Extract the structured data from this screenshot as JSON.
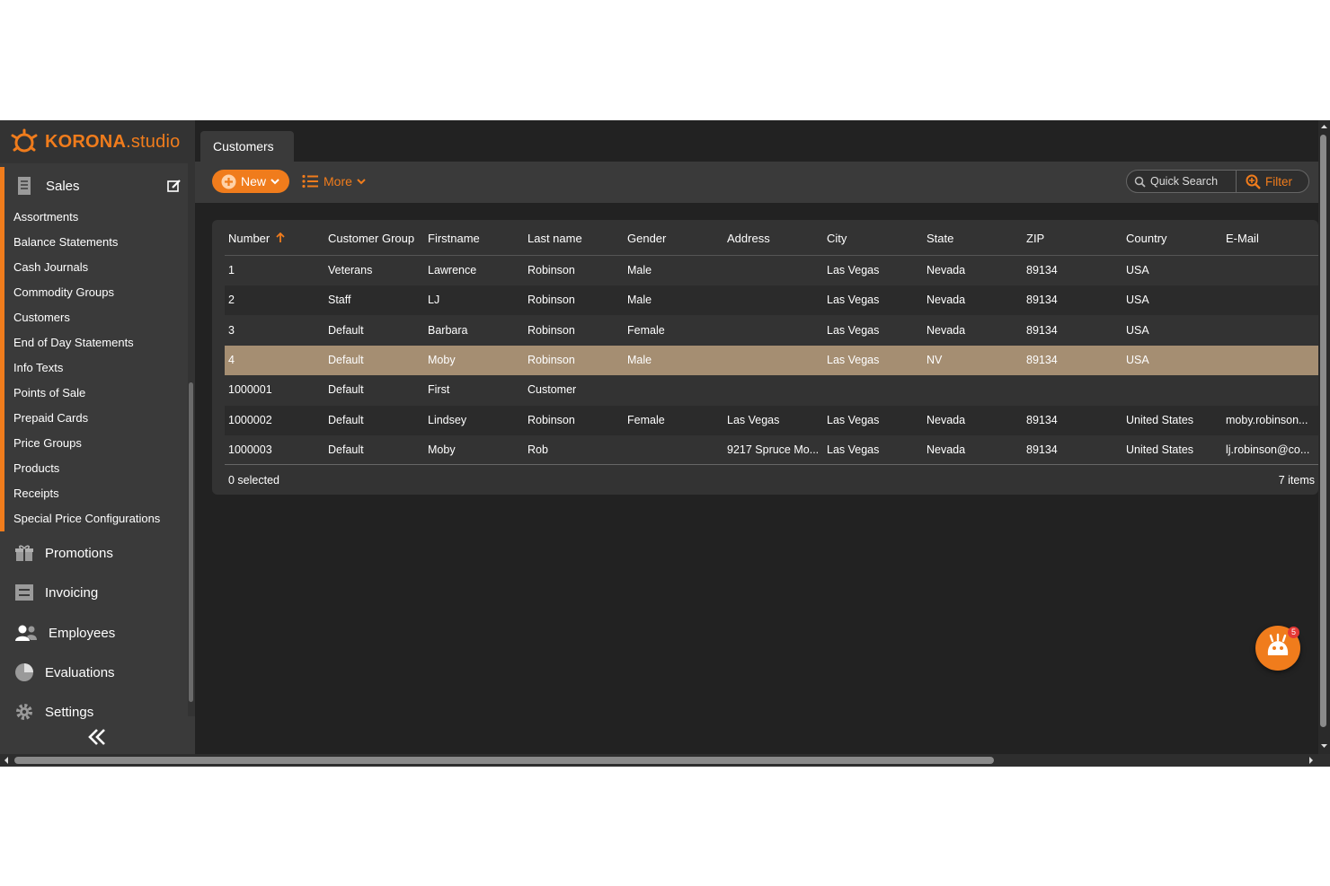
{
  "app": {
    "logo_bold": "KORONA",
    "logo_light": ".studio",
    "brand_color": "#f07c1c"
  },
  "sidebar": {
    "sales_label": "Sales",
    "sales_items": [
      "Assortments",
      "Balance Statements",
      "Cash Journals",
      "Commodity Groups",
      "Customers",
      "End of Day Statements",
      "Info Texts",
      "Points of Sale",
      "Prepaid Cards",
      "Price Groups",
      "Products",
      "Receipts",
      "Special Price Configurations"
    ],
    "nav": [
      {
        "label": "Promotions",
        "icon": "gift-icon"
      },
      {
        "label": "Invoicing",
        "icon": "invoice-icon"
      },
      {
        "label": "Employees",
        "icon": "users-icon"
      },
      {
        "label": "Evaluations",
        "icon": "pie-chart-icon"
      },
      {
        "label": "Settings",
        "icon": "gear-icon"
      }
    ]
  },
  "main": {
    "tab_label": "Customers",
    "toolbar": {
      "new_label": "New",
      "more_label": "More",
      "search_placeholder": "Quick Search",
      "filter_label": "Filter"
    },
    "table": {
      "columns": [
        "Number",
        "Customer Group",
        "Firstname",
        "Last name",
        "Gender",
        "Address",
        "City",
        "State",
        "ZIP",
        "Country",
        "E-Mail"
      ],
      "rows": [
        [
          "1",
          "Veterans",
          "Lawrence",
          "Robinson",
          "Male",
          "",
          "Las Vegas",
          "Nevada",
          "89134",
          "USA",
          ""
        ],
        [
          "2",
          "Staff",
          "LJ",
          "Robinson",
          "Male",
          "",
          "Las Vegas",
          "Nevada",
          "89134",
          "USA",
          ""
        ],
        [
          "3",
          "Default",
          "Barbara",
          "Robinson",
          "Female",
          "",
          "Las Vegas",
          "Nevada",
          "89134",
          "USA",
          ""
        ],
        [
          "4",
          "Default",
          "Moby",
          "Robinson",
          "Male",
          "",
          "Las Vegas",
          "NV",
          "89134",
          "USA",
          ""
        ],
        [
          "1000001",
          "Default",
          "First",
          "Customer",
          "",
          "",
          "",
          "",
          "",
          "",
          ""
        ],
        [
          "1000002",
          "Default",
          "Lindsey",
          "Robinson",
          "Female",
          "Las Vegas",
          "Las Vegas",
          "Nevada",
          "89134",
          "United States",
          "moby.robinson..."
        ],
        [
          "1000003",
          "Default",
          "Moby",
          "Rob",
          "",
          "9217 Spruce Mo...",
          "Las Vegas",
          "Nevada",
          "89134",
          "United States",
          "lj.robinson@co..."
        ]
      ],
      "selected_row_index": 3,
      "footer_left": "0 selected",
      "footer_right": "7 items"
    }
  },
  "chat": {
    "badge_count": "5"
  }
}
